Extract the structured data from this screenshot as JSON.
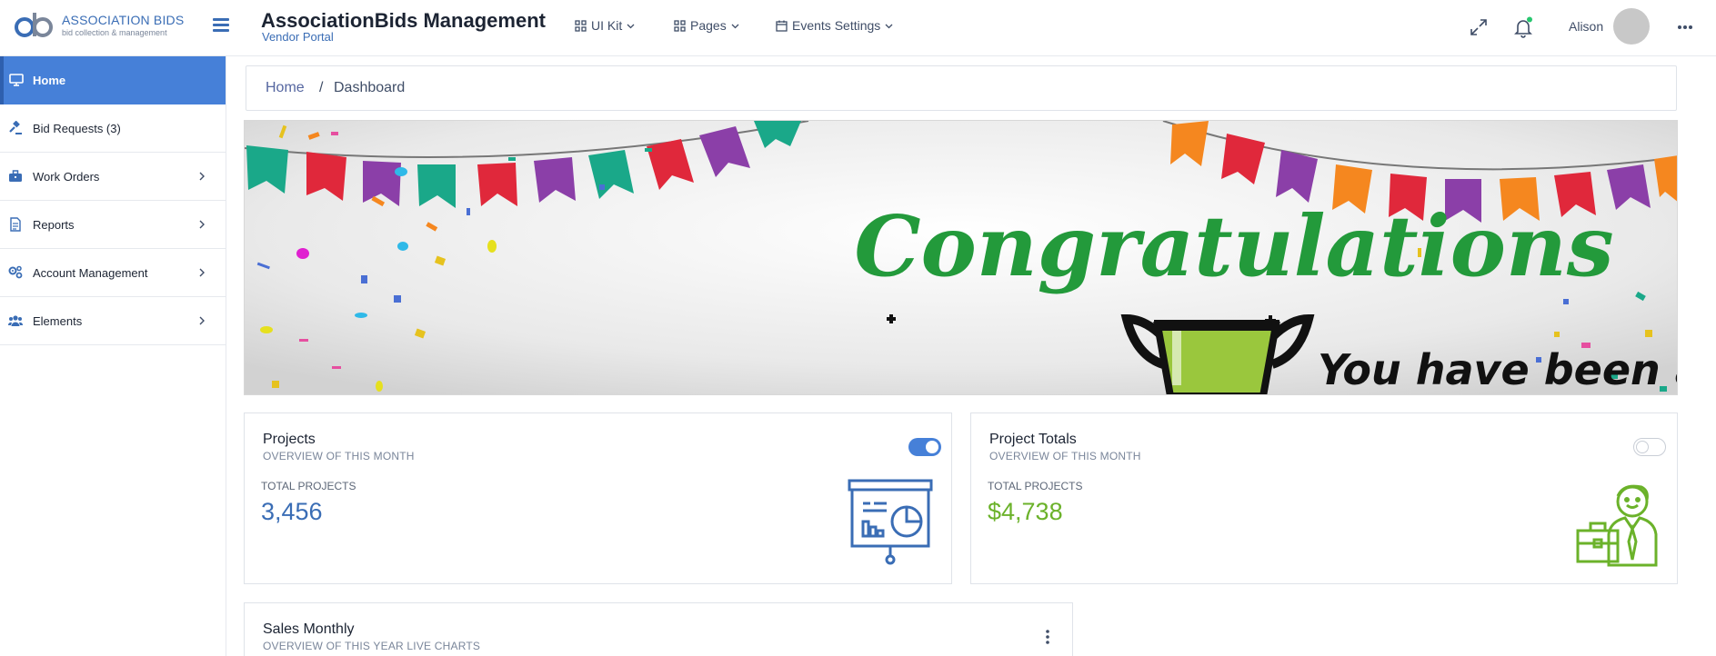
{
  "header": {
    "logo_name": "ASSOCIATION BIDS",
    "logo_tagline": "bid collection & management",
    "title": "AssociationBids Management",
    "subtitle": "Vendor Portal",
    "nav": [
      {
        "label": "UI Kit",
        "icon": "grid-icon"
      },
      {
        "label": "Pages",
        "icon": "grid-icon"
      },
      {
        "label": "Events Settings",
        "icon": "calendar-icon"
      }
    ],
    "user_name": "Alison",
    "notification_dot_color": "#28c76f"
  },
  "sidebar": {
    "items": [
      {
        "label": "Home",
        "icon": "monitor-icon",
        "active": true,
        "has_children": false
      },
      {
        "label": "Bid Requests (3)",
        "icon": "gavel-icon",
        "active": false,
        "has_children": false
      },
      {
        "label": "Work Orders",
        "icon": "briefcase-icon",
        "active": false,
        "has_children": true
      },
      {
        "label": "Reports",
        "icon": "document-icon",
        "active": false,
        "has_children": true
      },
      {
        "label": "Account Management",
        "icon": "gears-icon",
        "active": false,
        "has_children": true
      },
      {
        "label": "Elements",
        "icon": "users-icon",
        "active": false,
        "has_children": true
      }
    ]
  },
  "breadcrumb": {
    "home": "Home",
    "separator": "/",
    "current": "Dashboard"
  },
  "banner": {
    "headline": "Congratulations",
    "message": "You have been awarded"
  },
  "cards": {
    "projects": {
      "title": "Projects",
      "subtitle": "OVERVIEW OF THIS MONTH",
      "label": "TOTAL PROJECTS",
      "value": "3,456",
      "toggle_on": true,
      "value_color": "#3a6db5"
    },
    "project_totals": {
      "title": "Project Totals",
      "subtitle": "OVERVIEW OF THIS MONTH",
      "label": "TOTAL PROJECTS",
      "value": "$4,738",
      "toggle_on": false,
      "value_color": "#6bb22a"
    },
    "sales_monthly": {
      "title": "Sales Monthly",
      "subtitle": "OVERVIEW OF THIS YEAR LIVE CHARTS"
    }
  },
  "colors": {
    "accent": "#4680d8",
    "primary_blue": "#3a6db5",
    "success_green": "#6bb22a",
    "banner_green": "#239a3b"
  }
}
